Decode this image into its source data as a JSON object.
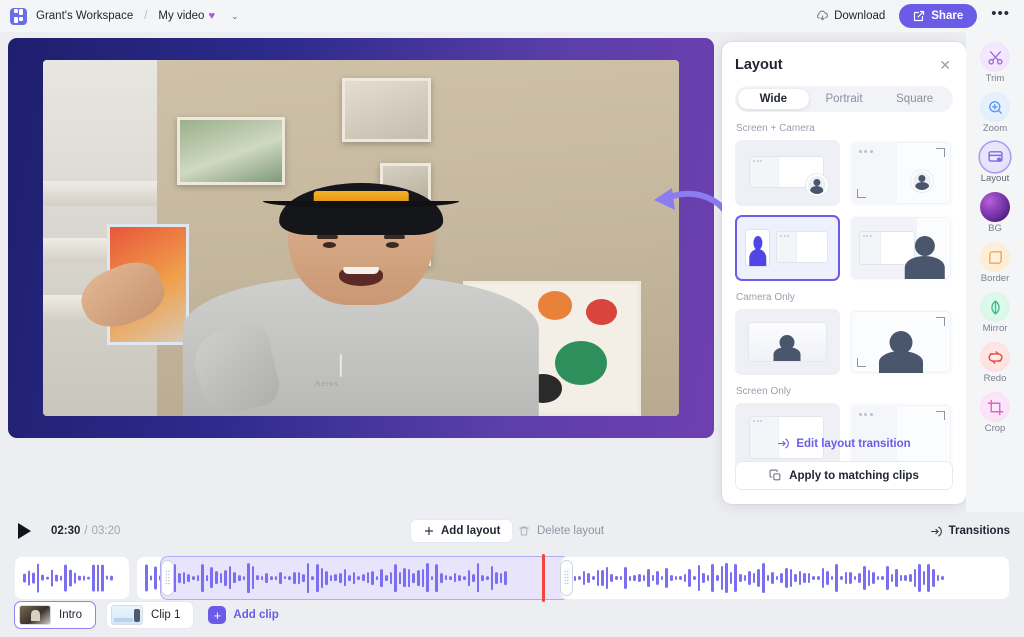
{
  "header": {
    "workspace_icon": "workspace-grid-icon",
    "workspace": "Grant's Workspace",
    "separator": "/",
    "document": "My video",
    "heart": "♥",
    "chevron": "⌄",
    "download_label": "Download",
    "download_icon": "download-cloud-icon",
    "share_label": "Share",
    "share_icon": "external-link-icon",
    "more_label": "•••",
    "accent": "#6b5ce7"
  },
  "stage": {
    "name": "video-preview",
    "bg_gradient_from": "#1e1f6e",
    "bg_gradient_to": "#6f3fb0",
    "annotation": "curved-arrow-pointing-left"
  },
  "panel": {
    "title": "Layout",
    "close": "✕",
    "tabs": [
      {
        "label": "Wide",
        "active": true
      },
      {
        "label": "Portrait",
        "active": false
      },
      {
        "label": "Square",
        "active": false
      }
    ],
    "sections": [
      {
        "label": "Screen + Camera",
        "options": [
          {
            "name": "screen-camera-pip",
            "selected": false
          },
          {
            "name": "screen-camera-fullbleed-pip",
            "selected": false
          },
          {
            "name": "screen-camera-side-by-side",
            "selected": true
          },
          {
            "name": "screen-camera-large-person",
            "selected": false
          }
        ]
      },
      {
        "label": "Camera Only",
        "options": [
          {
            "name": "camera-only-framed",
            "selected": false
          },
          {
            "name": "camera-only-fullbleed",
            "selected": false
          }
        ]
      },
      {
        "label": "Screen Only",
        "options": [
          {
            "name": "screen-only-framed",
            "selected": false
          },
          {
            "name": "screen-only-fullbleed",
            "selected": false
          }
        ]
      }
    ],
    "edit_transition_label": "Edit layout transition",
    "edit_transition_icon": "arrow-into-circle-icon",
    "apply_label": "Apply to matching clips",
    "apply_icon": "copy-icon",
    "link_color": "#6b5ce7"
  },
  "rail": {
    "tools": [
      {
        "label": "Trim",
        "icon": "scissors-icon",
        "active": false,
        "color": "#b388e8"
      },
      {
        "label": "Zoom",
        "icon": "magnifier-plus-icon",
        "active": false,
        "color": "#5b9bf0"
      },
      {
        "label": "Layout",
        "icon": "layout-icon",
        "active": true,
        "color": "#7b6ce8"
      },
      {
        "label": "BG",
        "icon": "sphere-gradient-icon",
        "active": false,
        "color": "#7b3fb0"
      },
      {
        "label": "Border",
        "icon": "rounded-square-icon",
        "active": false,
        "color": "#f0a94a"
      },
      {
        "label": "Mirror",
        "icon": "mirror-leaf-icon",
        "active": false,
        "color": "#3fbf8f"
      },
      {
        "label": "Redo",
        "icon": "redo-arrows-icon",
        "active": false,
        "color": "#e8493f"
      },
      {
        "label": "Crop",
        "icon": "crop-icon",
        "active": false,
        "color": "#e062c8"
      }
    ]
  },
  "timeline": {
    "play_icon": "play-icon",
    "current_time": "02:30",
    "time_separator": "/",
    "total_time": "03:20",
    "add_layout_label": "Add layout",
    "add_layout_icon": "plus-icon",
    "delete_layout_label": "Delete layout",
    "delete_layout_icon": "trash-icon",
    "transitions_label": "Transitions",
    "transitions_icon": "arrow-into-circle-icon",
    "playhead_color": "#f2463a",
    "waveform_color": "#7c6ef0",
    "selection_fill": "#e7e4fb",
    "selection_border": "#b3aaf3"
  },
  "clips": {
    "items": [
      {
        "label": "Intro",
        "active": true
      },
      {
        "label": "Clip 1",
        "active": false
      }
    ],
    "add_label": "Add clip",
    "add_icon": "plus-square-icon"
  }
}
